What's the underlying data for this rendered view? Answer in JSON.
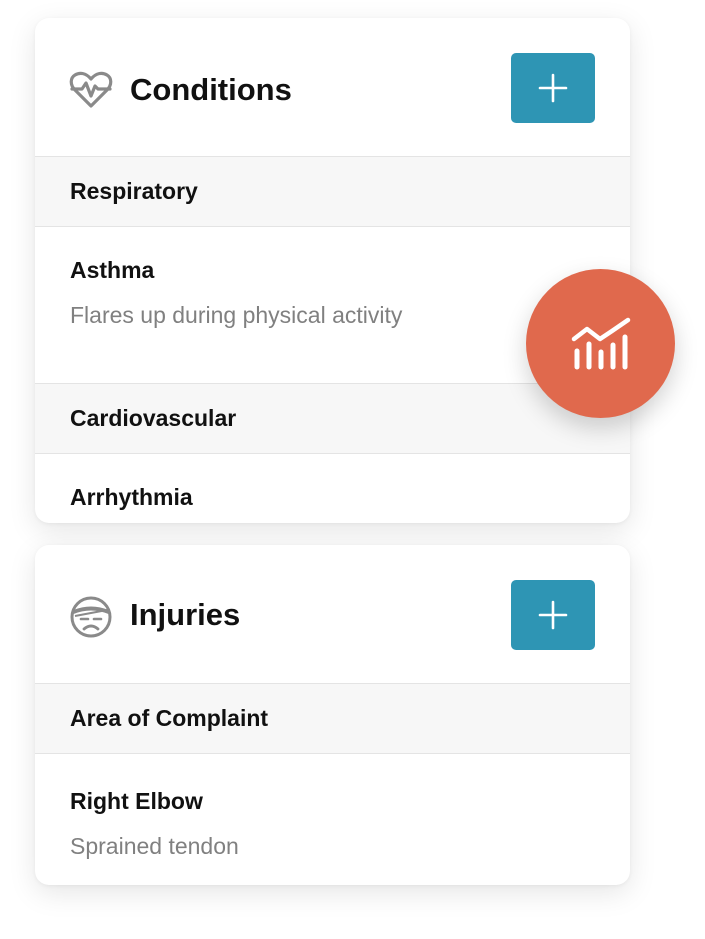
{
  "conditions": {
    "title": "Conditions",
    "header_icon": "heart-pulse-icon",
    "add_icon": "plus-icon",
    "groups": [
      {
        "label": "Respiratory",
        "items": [
          {
            "title": "Asthma",
            "description": "Flares up during physical activity"
          }
        ]
      },
      {
        "label": "Cardiovascular",
        "items": [
          {
            "title": "Arrhythmia",
            "description": ""
          }
        ]
      }
    ]
  },
  "injuries": {
    "title": "Injuries",
    "header_icon": "bandaged-face-icon",
    "add_icon": "plus-icon",
    "groups": [
      {
        "label": "Area of Complaint",
        "items": [
          {
            "title": "Right Elbow",
            "description": "Sprained tendon"
          }
        ]
      }
    ]
  },
  "fab": {
    "icon": "chart-trend-icon"
  },
  "colors": {
    "add_button": "#2e95b4",
    "fab": "#e0694d",
    "title_text": "#111111",
    "secondary_text": "#808080",
    "group_background": "#f7f7f7",
    "icon_gray": "#8a8a8a"
  }
}
